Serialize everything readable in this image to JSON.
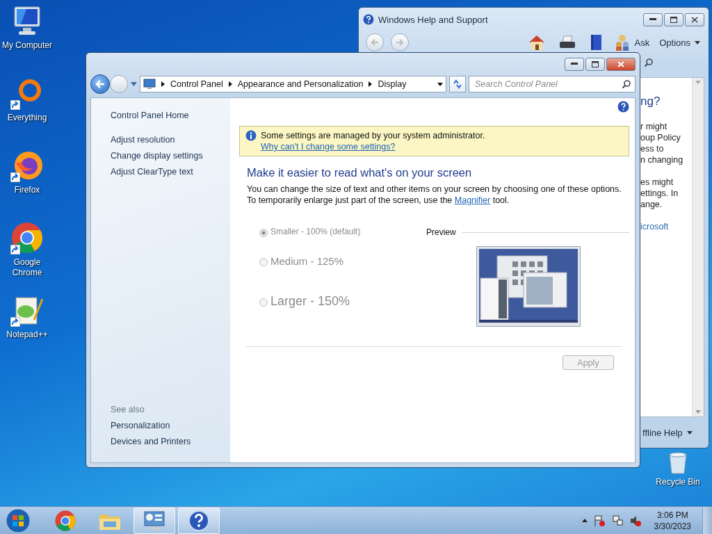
{
  "desktop_icons": [
    {
      "label": "My Computer",
      "kind": "computer",
      "shortcut": false
    },
    {
      "label": "Everything",
      "kind": "everything",
      "shortcut": true
    },
    {
      "label": "Firefox",
      "kind": "firefox",
      "shortcut": true
    },
    {
      "label": "Google Chrome",
      "kind": "chrome",
      "shortcut": true
    },
    {
      "label": "Notepad++",
      "kind": "notepad",
      "shortcut": true
    }
  ],
  "recycle_bin": {
    "label": "Recycle Bin"
  },
  "help_window": {
    "title": "Windows Help and Support",
    "ask": "Ask",
    "options": "Options",
    "content": [
      {
        "kind": "heading",
        "lines": [
          "ng?"
        ]
      },
      {
        "kind": "text",
        "lines": [
          "r might",
          "oup Policy",
          "ess to",
          "n changing"
        ]
      },
      {
        "kind": "text",
        "lines": [
          "es might",
          "ettings. In",
          "ange."
        ]
      },
      {
        "kind": "link",
        "lines": [
          "icrosoft"
        ]
      }
    ],
    "footer": "ffline Help"
  },
  "control_panel": {
    "breadcrumb": [
      "Control Panel",
      "Appearance and Personalization",
      "Display"
    ],
    "search": {
      "placeholder": "Search Control Panel"
    },
    "nav": {
      "home": "Control Panel Home",
      "links": [
        "Adjust resolution",
        "Change display settings",
        "Adjust ClearType text"
      ],
      "see_also_title": "See also",
      "see_also": [
        "Personalization",
        "Devices and Printers"
      ]
    },
    "info_bar": {
      "message": "Some settings are managed by your system administrator.",
      "link": "Why can't I change some settings?"
    },
    "heading": "Make it easier to read what's on your screen",
    "description": {
      "before": "You can change the size of text and other items on your screen by choosing one of these options. To temporarily enlarge just part of the screen, use the ",
      "link": "Magnifier",
      "after": " tool."
    },
    "options": [
      {
        "label": "Smaller - 100% (default)",
        "kind": "small",
        "selected": true,
        "disabled": true
      },
      {
        "label": "Medium - 125%",
        "kind": "medium",
        "selected": false,
        "disabled": true
      },
      {
        "label": "Larger - 150%",
        "kind": "large",
        "selected": false,
        "disabled": true
      }
    ],
    "preview_label": "Preview",
    "apply": {
      "label": "Apply",
      "disabled": true
    }
  },
  "taskbar": {
    "items": [
      {
        "kind": "chrome",
        "open": false
      },
      {
        "kind": "explorer",
        "open": false
      },
      {
        "kind": "control-panel",
        "open": true
      },
      {
        "kind": "help",
        "open": true
      }
    ],
    "time": "3:06 PM",
    "date": "3/30/2023"
  }
}
